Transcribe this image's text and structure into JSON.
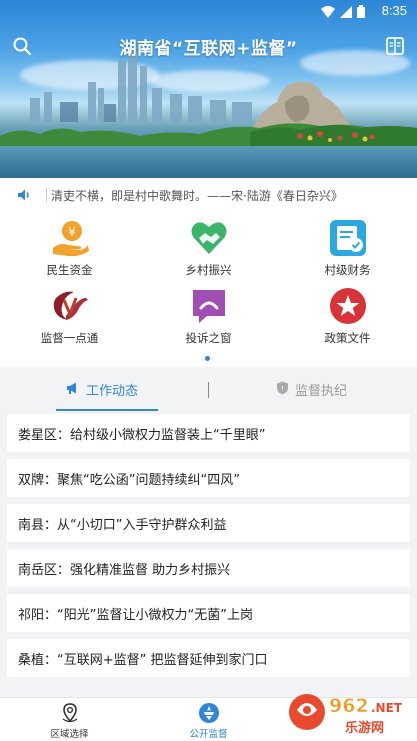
{
  "status_bar": {
    "time": "8:35"
  },
  "header": {
    "title": "湖南省“互联网+监督”"
  },
  "ticker": {
    "text": "清吏不横，即是村中歌舞时。——宋·陆游《春日杂兴》"
  },
  "grid": {
    "items": [
      {
        "label": "民生资金",
        "icon": "money-hand-icon"
      },
      {
        "label": "乡村振兴",
        "icon": "heart-handshake-icon"
      },
      {
        "label": "村级财务",
        "icon": "finance-check-icon"
      },
      {
        "label": "监督一点通",
        "icon": "supervision-logo-icon"
      },
      {
        "label": "投诉之窗",
        "icon": "complaint-window-icon"
      },
      {
        "label": "政策文件",
        "icon": "star-badge-icon"
      }
    ]
  },
  "tabs": [
    {
      "label": "工作动态",
      "active": true
    },
    {
      "label": "监督执纪",
      "active": false
    }
  ],
  "news": [
    {
      "text": "娄星区：给村级小微权力监督装上“千里眼”"
    },
    {
      "text": "双牌：聚焦“吃公函”问题持续纠“四风”"
    },
    {
      "text": "南县：从“小切口”入手守护群众利益"
    },
    {
      "text": "南岳区：强化精准监督 助力乡村振兴"
    },
    {
      "text": "祁阳：“阳光”监督让小微权力“无菌”上岗"
    },
    {
      "text": "桑植：“互联网+监督” 把监督延伸到家门口"
    }
  ],
  "bottom_nav": [
    {
      "label": "区域选择",
      "active": false
    },
    {
      "label": "公开监督",
      "active": true
    },
    {
      "label": "",
      "active": false
    }
  ],
  "watermark": {
    "text": "962.NET",
    "sub": "乐游网"
  },
  "colors": {
    "accent": "#2d86d6",
    "red": "#d9333a",
    "orange": "#f2a12b",
    "green": "#3bb56a",
    "purple": "#a24fb5"
  }
}
